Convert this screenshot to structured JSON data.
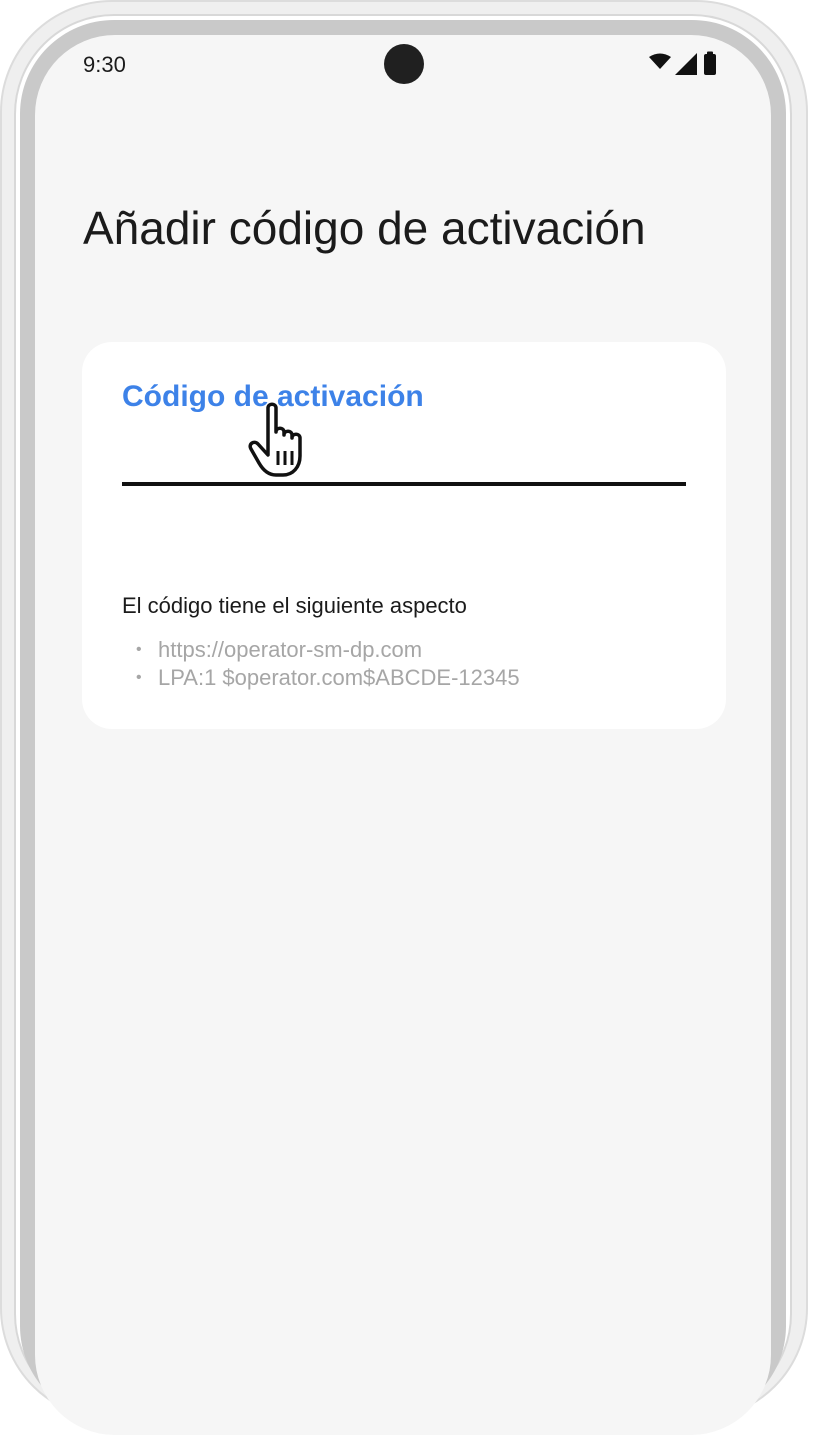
{
  "status_bar": {
    "time": "9:30",
    "icons": [
      "wifi-icon",
      "signal-icon",
      "battery-icon"
    ]
  },
  "page": {
    "title": "Añadir código de activación"
  },
  "activation_field": {
    "label": "Código de activación",
    "value": "",
    "accent_color": "#3d82e8"
  },
  "hint": {
    "title": "El código tiene el siguiente aspecto",
    "bullet": "•",
    "examples": [
      "https://operator-sm-dp.com",
      "LPA:1 $operator.com$ABCDE-12345"
    ]
  },
  "pointer": {
    "icon": "hand-pointer-icon"
  }
}
